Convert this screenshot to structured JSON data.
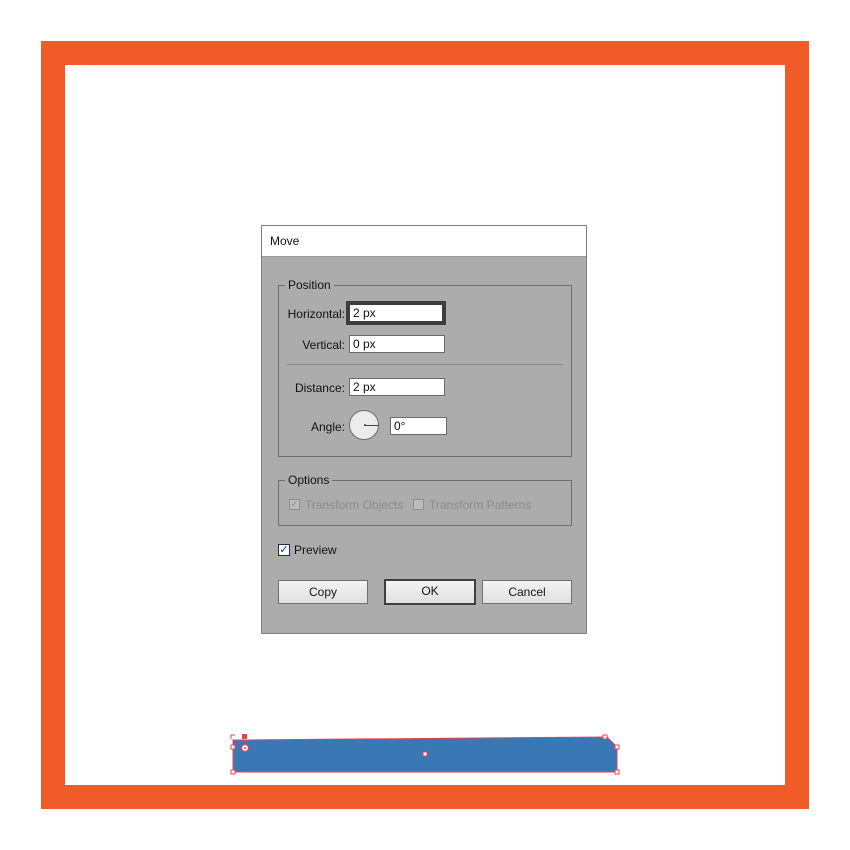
{
  "colors": {
    "frame": "#f15a29",
    "canvas": "#ffffff",
    "dialog_bg": "#acacac",
    "shape_fill": "#3a78b5",
    "selection": "#e8404e"
  },
  "dialog": {
    "title": "Move",
    "position_group": {
      "label": "Position",
      "horizontal_label": "Horizontal:",
      "horizontal_value": "2 px",
      "vertical_label": "Vertical:",
      "vertical_value": "0 px",
      "distance_label": "Distance:",
      "distance_value": "2 px",
      "angle_label": "Angle:",
      "angle_value": "0°"
    },
    "options_group": {
      "label": "Options",
      "transform_objects_label": "Transform Objects",
      "transform_objects_checked": true,
      "transform_patterns_label": "Transform Patterns",
      "transform_patterns_checked": false
    },
    "preview_label": "Preview",
    "preview_checked": true,
    "buttons": {
      "copy": "Copy",
      "ok": "OK",
      "cancel": "Cancel"
    }
  },
  "icons": {
    "check": "✓"
  }
}
